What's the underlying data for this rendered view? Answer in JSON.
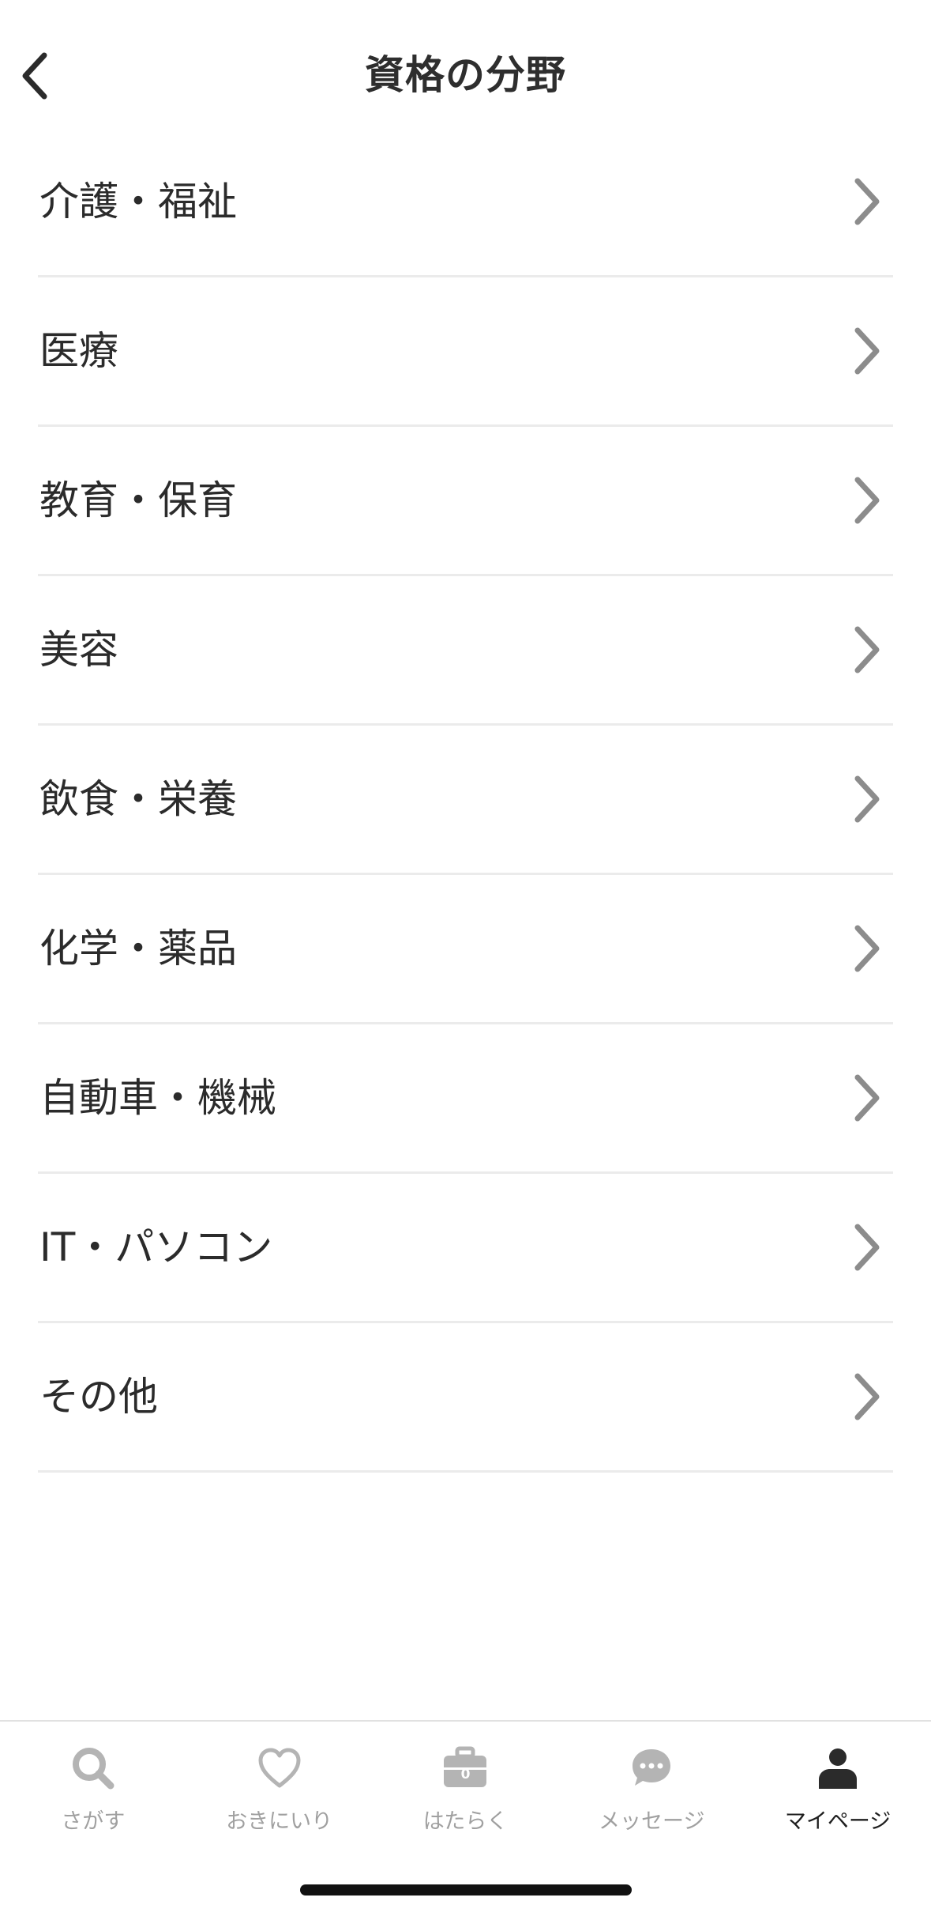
{
  "header": {
    "title": "資格の分野",
    "back_icon": "chevron-left-icon"
  },
  "categories": [
    {
      "label": "介護・福祉"
    },
    {
      "label": "医療"
    },
    {
      "label": "教育・保育"
    },
    {
      "label": "美容"
    },
    {
      "label": "飲食・栄養"
    },
    {
      "label": "化学・薬品"
    },
    {
      "label": "自動車・機械"
    },
    {
      "label": "IT・パソコン"
    },
    {
      "label": "その他"
    }
  ],
  "tabbar": {
    "tabs": [
      {
        "label": "さがす",
        "icon": "search-icon",
        "active": false
      },
      {
        "label": "おきにいり",
        "icon": "heart-icon",
        "active": false
      },
      {
        "label": "はたらく",
        "icon": "briefcase-icon",
        "badge": "0",
        "active": false
      },
      {
        "label": "メッセージ",
        "icon": "chat-bubble-icon",
        "active": false
      },
      {
        "label": "マイページ",
        "icon": "person-icon",
        "active": true
      }
    ]
  },
  "colors": {
    "text": "#2b2b2b",
    "divider": "#ebebeb",
    "chevron": "#8c8c8c",
    "tab_inactive": "#b4b4b4",
    "tab_active": "#1e1e1e"
  }
}
